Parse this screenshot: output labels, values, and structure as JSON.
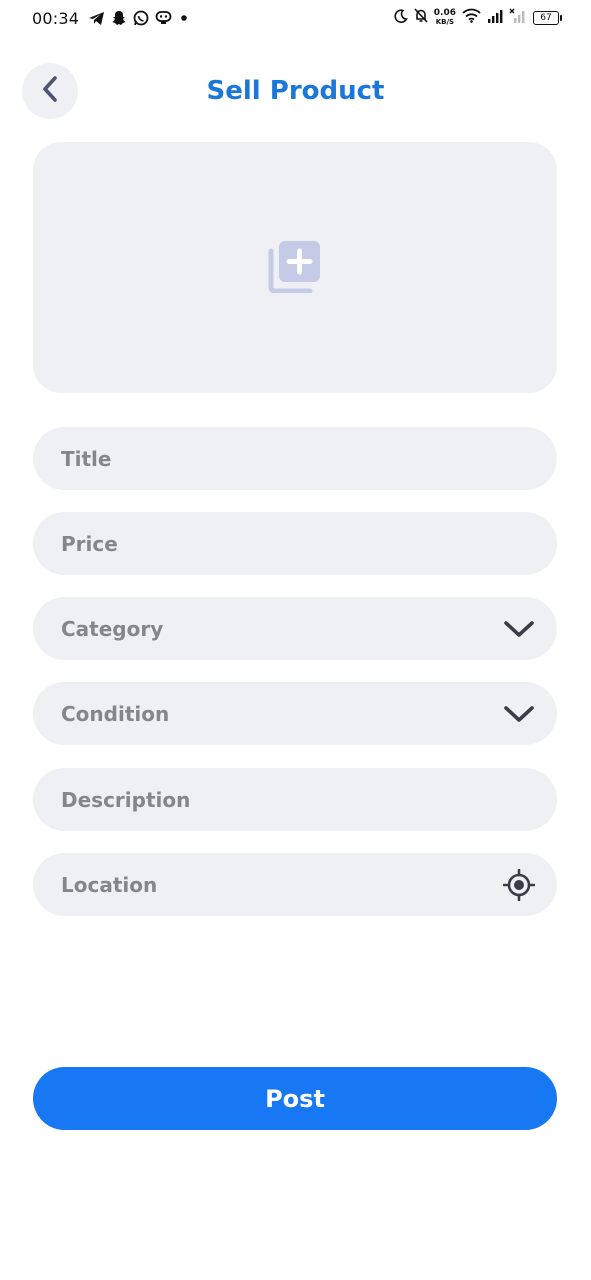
{
  "status_bar": {
    "time": "00:34",
    "net_speed_value": "0.06",
    "net_speed_unit": "KB/S",
    "battery": "67"
  },
  "header": {
    "title": "Sell Product"
  },
  "form": {
    "title_placeholder": "Title",
    "price_placeholder": "Price",
    "category_placeholder": "Category",
    "condition_placeholder": "Condition",
    "description_placeholder": "Description",
    "location_placeholder": "Location"
  },
  "actions": {
    "post_label": "Post"
  },
  "colors": {
    "accent": "#1877f2",
    "title": "#1c78d8",
    "field_bg": "#eff0f4",
    "placeholder": "#84868c",
    "add_photo_icon": "#c5cbe6"
  },
  "icons": {
    "back": "chevron-left-icon",
    "add_photo": "add-photo-library-icon",
    "dropdown": "chevron-down-icon",
    "location": "gps-target-icon"
  }
}
